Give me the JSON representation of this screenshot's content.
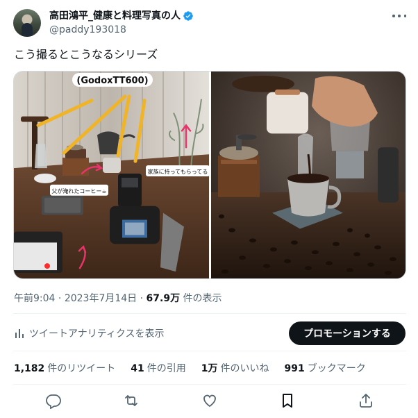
{
  "author": {
    "display_name": "高田鴻平_健康と料理写真の人",
    "handle": "@paddy193018",
    "verified": true,
    "verified_color": "#1d9bf0"
  },
  "tweet": {
    "text": "こう撮るとこうなるシリーズ",
    "time": "午前9:04",
    "date": "2023年7月14日",
    "views_count": "67.9万",
    "views_label": "件の表示"
  },
  "media": {
    "photo1_labels": {
      "device": "(GodoxTT600)",
      "family": "家族に持ってもらってる",
      "father": "父が淹れたコーヒー☕"
    }
  },
  "analytics": {
    "label": "ツイートアナリティクスを表示",
    "promote_label": "プロモーションする"
  },
  "stats": {
    "retweets_count": "1,182",
    "retweets_label": "件のリツイート",
    "quotes_count": "41",
    "quotes_label": "件の引用",
    "likes_count": "1万",
    "likes_label": "件のいいね",
    "bookmarks_count": "991",
    "bookmarks_label": "ブックマーク"
  },
  "icons": {
    "reply": "reply-icon",
    "retweet": "retweet-icon",
    "like": "heart-icon",
    "bookmark": "bookmark-icon",
    "share": "share-icon",
    "more": "more-icon",
    "analytics": "analytics-icon"
  },
  "colors": {
    "text": "#0f1419",
    "secondary": "#536471",
    "divider": "#eff3f4",
    "button": "#0f1419"
  }
}
